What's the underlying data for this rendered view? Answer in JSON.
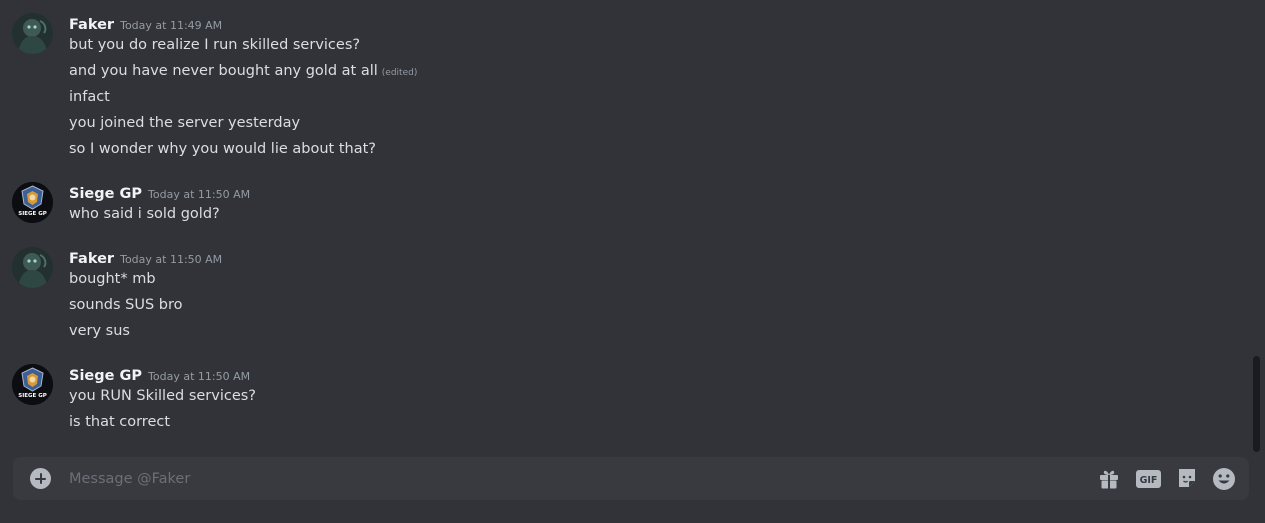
{
  "messages": [
    {
      "author": "Faker",
      "avatar": "faker-avatar",
      "timestamp": "Today at 11:49 AM",
      "lines": [
        {
          "text": "but you do realize I run skilled services?"
        },
        {
          "text": "and you have never bought any gold at all",
          "edited": "(edited)"
        },
        {
          "text": "infact"
        },
        {
          "text": "you joined the server yesterday"
        },
        {
          "text": "so I wonder why you would lie about that?"
        }
      ]
    },
    {
      "author": "Siege GP",
      "avatar": "siege-gp-avatar",
      "avatar_text": "SIEGE GP",
      "timestamp": "Today at 11:50 AM",
      "lines": [
        {
          "text": "who said i sold gold?"
        }
      ]
    },
    {
      "author": "Faker",
      "avatar": "faker-avatar",
      "timestamp": "Today at 11:50 AM",
      "lines": [
        {
          "text": "bought* mb"
        },
        {
          "text": "sounds SUS bro"
        },
        {
          "text": "very sus"
        }
      ]
    },
    {
      "author": "Siege GP",
      "avatar": "siege-gp-avatar",
      "avatar_text": "SIEGE GP",
      "timestamp": "Today at 11:50 AM",
      "lines": [
        {
          "text": "you RUN Skilled services?"
        },
        {
          "text": "is that correct"
        }
      ]
    }
  ],
  "composer": {
    "placeholder": "Message @Faker",
    "gif_label": "GIF",
    "icons": [
      "plus-circle-icon",
      "gift-icon",
      "gif-icon",
      "sticker-icon",
      "emoji-icon"
    ]
  },
  "colors": {
    "background": "#313338",
    "composer": "#383a40",
    "author": "#f2f3f5",
    "text": "#dbdee1",
    "muted": "#949ba4"
  }
}
